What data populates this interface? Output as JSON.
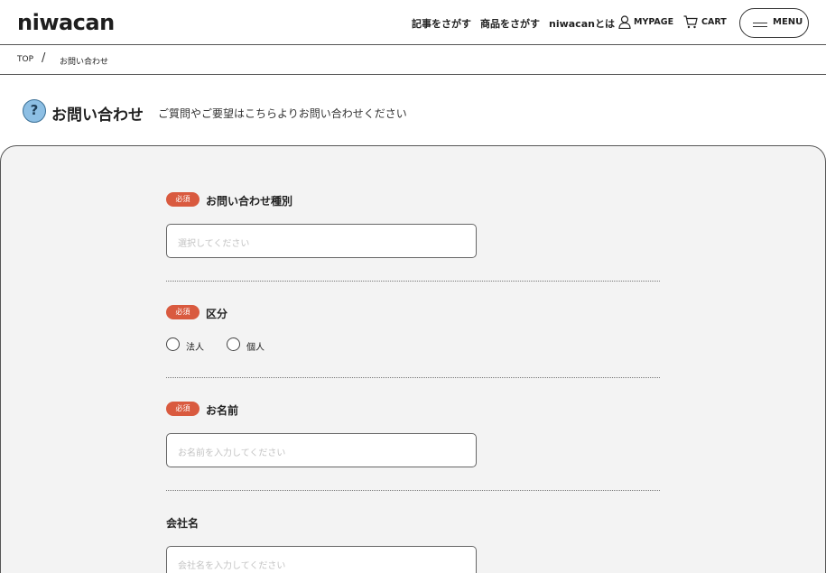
{
  "header": {
    "logo": "niwacan",
    "nav": [
      "記事をさがす",
      "商品をさがす",
      "niwacanとは"
    ],
    "mypage": "MYPAGE",
    "cart": "CART",
    "menu": "MENU"
  },
  "breadcrumb": {
    "top": "TOP",
    "separator": "/",
    "current": "お問い合わせ"
  },
  "page": {
    "icon_glyph": "?",
    "title": "お問い合わせ",
    "subtitle": "ご質問やご要望はこちらよりお問い合わせください"
  },
  "form": {
    "required_badge": "必須",
    "inquiry_type": {
      "label": "お問い合わせ種別",
      "placeholder": "選択してください"
    },
    "category": {
      "label": "区分",
      "options": [
        "法人",
        "個人"
      ]
    },
    "name": {
      "label": "お名前",
      "placeholder": "お名前を入力してください"
    },
    "company": {
      "label": "会社名",
      "placeholder": "会社名を入力してください"
    }
  },
  "colors": {
    "badge": "#d95a3f",
    "question_icon": "#8dbfe4",
    "panel_bg": "#f3f3f3"
  },
  "icons": {
    "mypage": "user-icon",
    "cart": "cart-icon",
    "menu": "hamburger-icon",
    "page": "question-icon"
  }
}
